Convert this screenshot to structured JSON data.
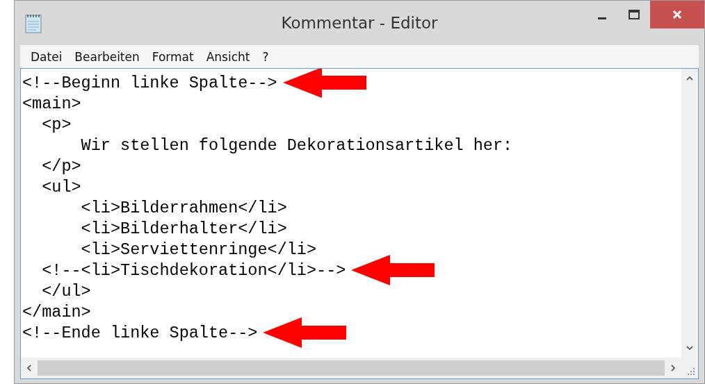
{
  "window": {
    "title": "Kommentar - Editor"
  },
  "menu": [
    "Datei",
    "Bearbeiten",
    "Format",
    "Ansicht",
    "?"
  ],
  "editor": {
    "lines": [
      {
        "text": "<!--Beginn linke Spalte-->",
        "marked": true
      },
      {
        "text": "<main>",
        "marked": false
      },
      {
        "text": "  <p>",
        "marked": false
      },
      {
        "text": "      Wir stellen folgende Dekorationsartikel her:",
        "marked": false
      },
      {
        "text": "  </p>",
        "marked": false
      },
      {
        "text": "  <ul>",
        "marked": false
      },
      {
        "text": "      <li>Bilderrahmen</li>",
        "marked": false
      },
      {
        "text": "      <li>Bilderhalter</li>",
        "marked": false
      },
      {
        "text": "      <li>Serviettenringe</li>",
        "marked": false
      },
      {
        "text": "  <!--<li>Tischdekoration</li>-->",
        "marked": true
      },
      {
        "text": "  </ul>",
        "marked": false
      },
      {
        "text": "</main>",
        "marked": false
      },
      {
        "text": "<!--Ende linke Spalte-->",
        "marked": true
      }
    ]
  }
}
